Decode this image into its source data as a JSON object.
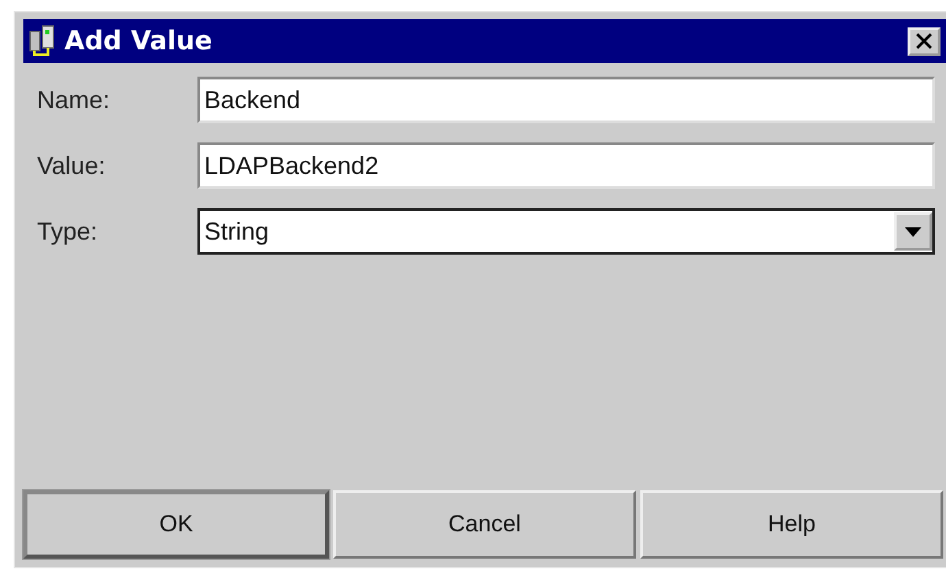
{
  "window": {
    "title": "Add Value"
  },
  "fields": [
    {
      "label": "Name:",
      "value": "Backend",
      "kind": "text"
    },
    {
      "label": "Value:",
      "value": "LDAPBackend2",
      "kind": "text"
    },
    {
      "label": "Type:",
      "value": "String",
      "kind": "select"
    }
  ],
  "buttons": [
    {
      "label": "OK",
      "default": true
    },
    {
      "label": "Cancel",
      "default": false
    },
    {
      "label": "Help",
      "default": false
    }
  ]
}
